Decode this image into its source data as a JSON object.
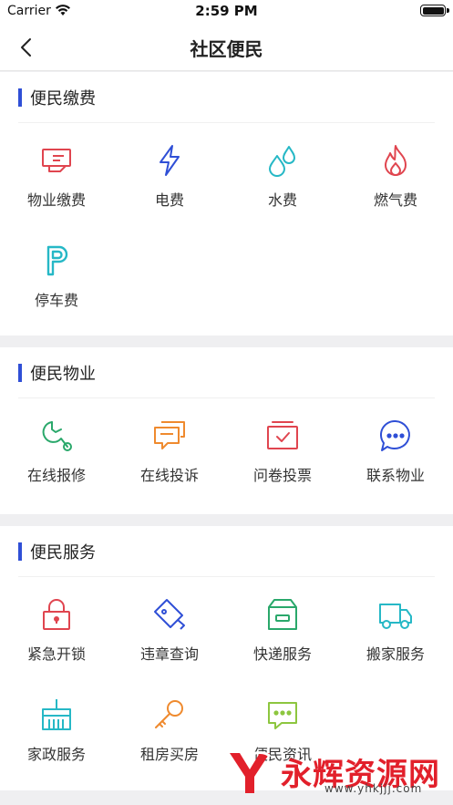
{
  "status_bar": {
    "carrier": "Carrier",
    "time": "2:59 PM"
  },
  "nav": {
    "title": "社区便民"
  },
  "sections": [
    {
      "title": "便民缴费",
      "items": [
        {
          "label": "物业缴费",
          "icon": "property-fee-icon",
          "color": "#e0454f"
        },
        {
          "label": "电费",
          "icon": "lightning-icon",
          "color": "#2f4fd6"
        },
        {
          "label": "水费",
          "icon": "water-drop-icon",
          "color": "#26b8c6"
        },
        {
          "label": "燃气费",
          "icon": "flame-icon",
          "color": "#e0454f"
        },
        {
          "label": "停车费",
          "icon": "parking-icon",
          "color": "#26b8c6"
        }
      ]
    },
    {
      "title": "便民物业",
      "items": [
        {
          "label": "在线报修",
          "icon": "wrench-icon",
          "color": "#2aa86b"
        },
        {
          "label": "在线投诉",
          "icon": "chat-bubbles-icon",
          "color": "#ef8a2e"
        },
        {
          "label": "问卷投票",
          "icon": "ballot-box-icon",
          "color": "#e0454f"
        },
        {
          "label": "联系物业",
          "icon": "message-dots-icon",
          "color": "#2f4fd6"
        }
      ]
    },
    {
      "title": "便民服务",
      "items": [
        {
          "label": "紧急开锁",
          "icon": "padlock-icon",
          "color": "#e0454f"
        },
        {
          "label": "违章查询",
          "icon": "violation-tag-icon",
          "color": "#2f4fd6"
        },
        {
          "label": "快递服务",
          "icon": "package-box-icon",
          "color": "#2aa86b"
        },
        {
          "label": "搬家服务",
          "icon": "moving-truck-icon",
          "color": "#26b8c6"
        },
        {
          "label": "家政服务",
          "icon": "broom-icon",
          "color": "#26b8c6"
        },
        {
          "label": "租房买房",
          "icon": "key-icon",
          "color": "#ef8a2e"
        },
        {
          "label": "便民资讯",
          "icon": "info-chat-icon",
          "color": "#8dc63f"
        }
      ]
    }
  ],
  "watermark": {
    "title": "永辉资源网",
    "url": "www.yhkjjj.com"
  }
}
